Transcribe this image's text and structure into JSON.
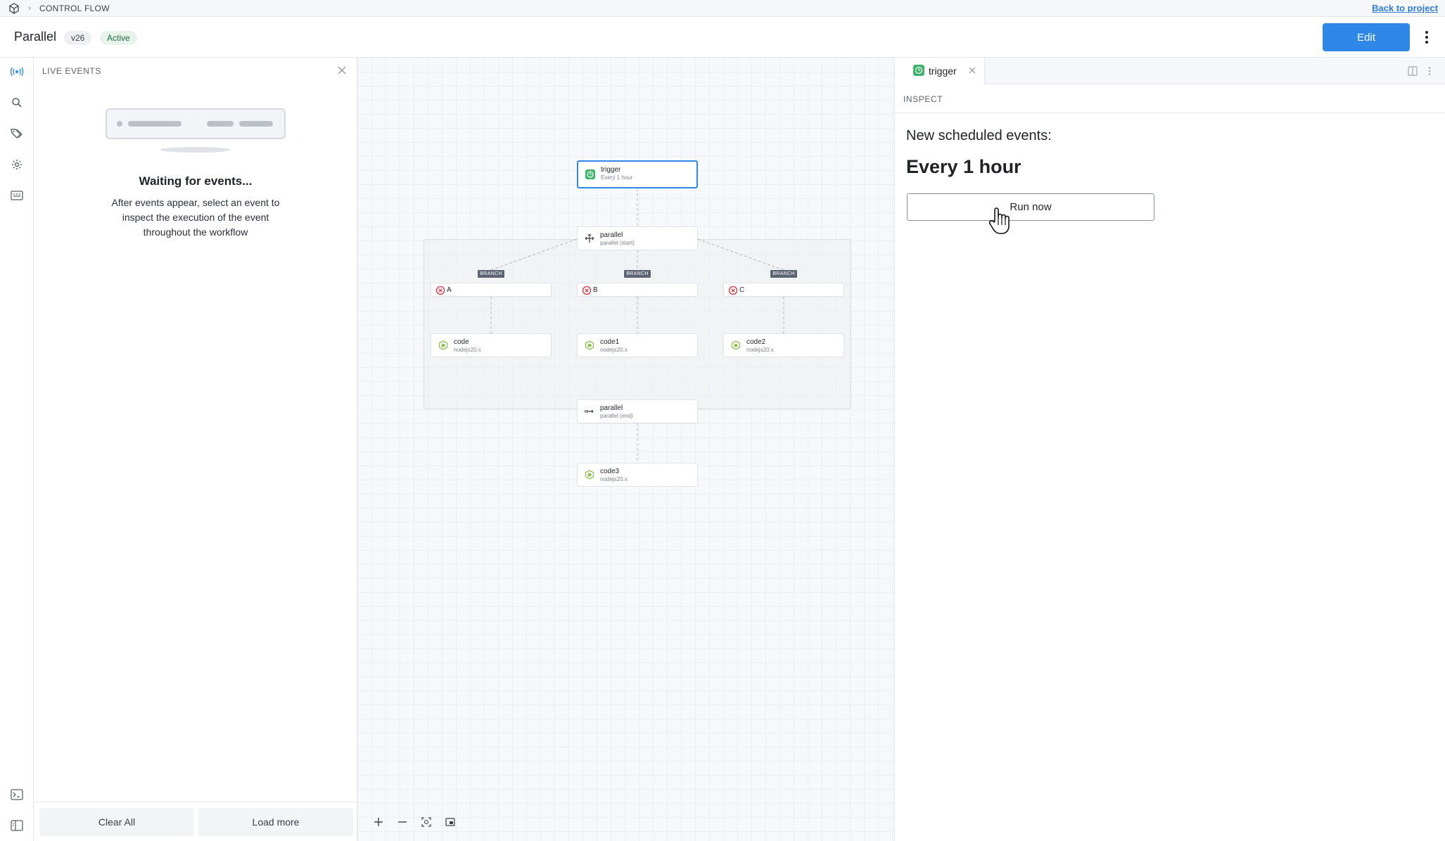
{
  "topbar": {
    "breadcrumb": "CONTROL FLOW",
    "back_link": "Back to project"
  },
  "header": {
    "title": "Parallel",
    "version": "v26",
    "status": "Active",
    "edit_label": "Edit"
  },
  "rail": {
    "icons": [
      "live-events-icon",
      "search-icon",
      "tags-icon",
      "settings-icon",
      "keyboard-icon",
      "terminal-icon",
      "panel-toggle-icon"
    ]
  },
  "live_events": {
    "title": "LIVE EVENTS",
    "waiting_title": "Waiting for events...",
    "waiting_desc": "After events appear, select an event to inspect the execution of the event throughout the workflow",
    "clear_label": "Clear All",
    "load_label": "Load more"
  },
  "workflow": {
    "trigger": {
      "label": "trigger",
      "sub": "Every 1 hour"
    },
    "parallel_start": {
      "label": "parallel",
      "sub": "parallel (start)"
    },
    "branch_tag": "BRANCH",
    "branches": [
      {
        "label": "A",
        "code_label": "code",
        "code_sub": "nodejs20.x"
      },
      {
        "label": "B",
        "code_label": "code1",
        "code_sub": "nodejs20.x"
      },
      {
        "label": "C",
        "code_label": "code2",
        "code_sub": "nodejs20.x"
      }
    ],
    "parallel_end": {
      "label": "parallel",
      "sub": "parallel (end)"
    },
    "final": {
      "label": "code3",
      "sub": "nodejs20.x"
    }
  },
  "inspect": {
    "tab_label": "trigger",
    "section": "INSPECT",
    "heading": "New scheduled events:",
    "value": "Every 1 hour",
    "run_label": "Run now"
  },
  "colors": {
    "accent": "#2f88e8",
    "success": "#3bb36a",
    "error": "#d9363e",
    "code": "#8cc152"
  }
}
